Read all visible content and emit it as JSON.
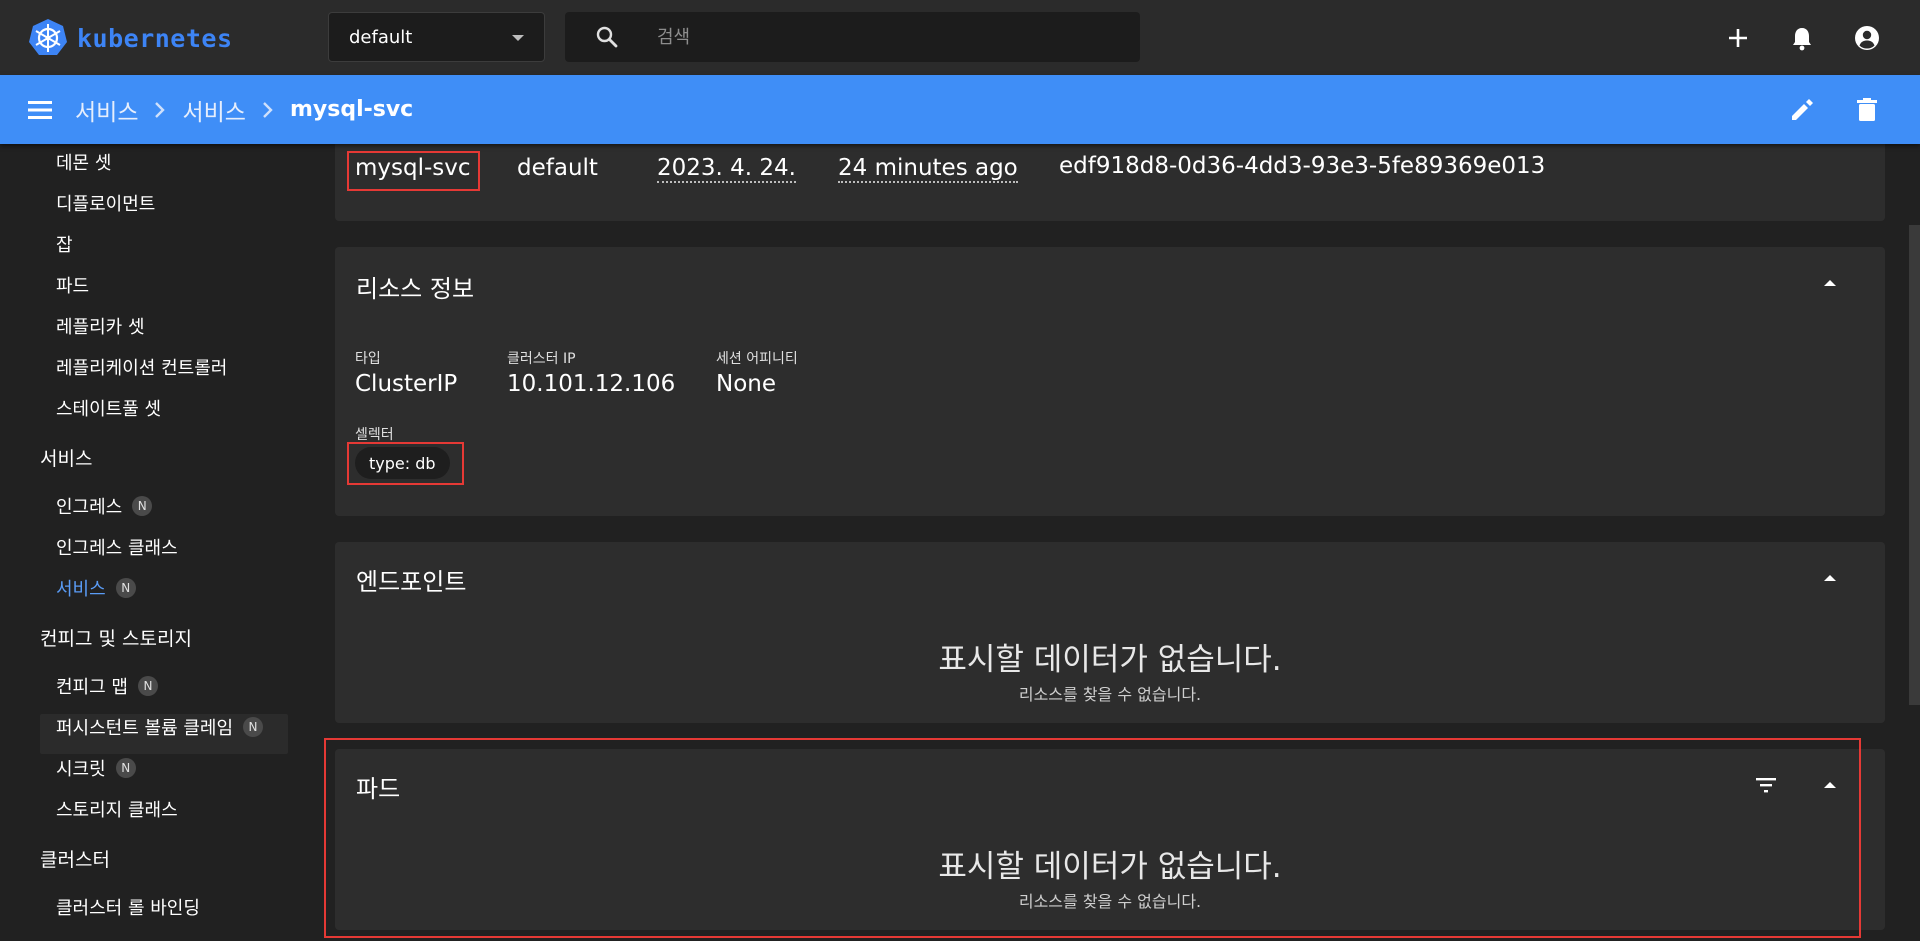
{
  "brand": {
    "name": "kubernetes",
    "color": "#3d84f5"
  },
  "namespace_select": {
    "value": "default"
  },
  "search": {
    "placeholder": "검색",
    "icon": "search-icon"
  },
  "top_actions": [
    {
      "name": "add-icon"
    },
    {
      "name": "notifications-icon"
    },
    {
      "name": "account-icon"
    }
  ],
  "breadcrumb": {
    "items": [
      "서비스",
      "서비스"
    ],
    "current": "mysql-svc"
  },
  "bar_actions": [
    {
      "name": "edit-icon"
    },
    {
      "name": "delete-icon"
    }
  ],
  "sidebar": {
    "items": [
      {
        "label": "데몬 셋"
      },
      {
        "label": "디플로이먼트"
      },
      {
        "label": "잡"
      },
      {
        "label": "파드"
      },
      {
        "label": "레플리카 셋"
      },
      {
        "label": "레플리케이션 컨트롤러"
      },
      {
        "label": "스테이트풀 셋"
      }
    ],
    "group_services": "서비스",
    "services_items": [
      {
        "label": "인그레스",
        "badge": "N"
      },
      {
        "label": "인그레스 클래스"
      },
      {
        "label": "서비스",
        "badge": "N",
        "active": true
      }
    ],
    "group_config": "컨피그 및 스토리지",
    "config_items": [
      {
        "label": "컨피그 맵",
        "badge": "N"
      },
      {
        "label": "퍼시스턴트 볼륨 클레임",
        "badge": "N"
      },
      {
        "label": "시크릿",
        "badge": "N"
      },
      {
        "label": "스토리지 클래스"
      }
    ],
    "group_cluster": "클러스터",
    "cluster_items": [
      {
        "label": "클러스터 롤 바인딩"
      }
    ],
    "active_color": "#5a9cf6"
  },
  "metadata": {
    "name": "mysql-svc",
    "namespace": "default",
    "created": "2023. 4. 24.",
    "age": "24 minutes ago",
    "uid": "edf918d8-0d36-4dd3-93e3-5fe89369e013"
  },
  "resource_info": {
    "title": "리소스 정보",
    "type_label": "타입",
    "type_value": "ClusterIP",
    "cluster_ip_label": "클러스터 IP",
    "cluster_ip_value": "10.101.12.106",
    "session_label": "세션 어피니티",
    "session_value": "None",
    "selector_label": "셀렉터",
    "selector_chip": "type: db"
  },
  "endpoints": {
    "title": "엔드포인트",
    "empty_title": "표시할 데이터가 없습니다.",
    "empty_sub": "리소스를 찾을 수 없습니다."
  },
  "pods": {
    "title": "파드",
    "empty_title": "표시할 데이터가 없습니다.",
    "empty_sub": "리소스를 찾을 수 없습니다."
  },
  "highlight_color": "#e53935"
}
